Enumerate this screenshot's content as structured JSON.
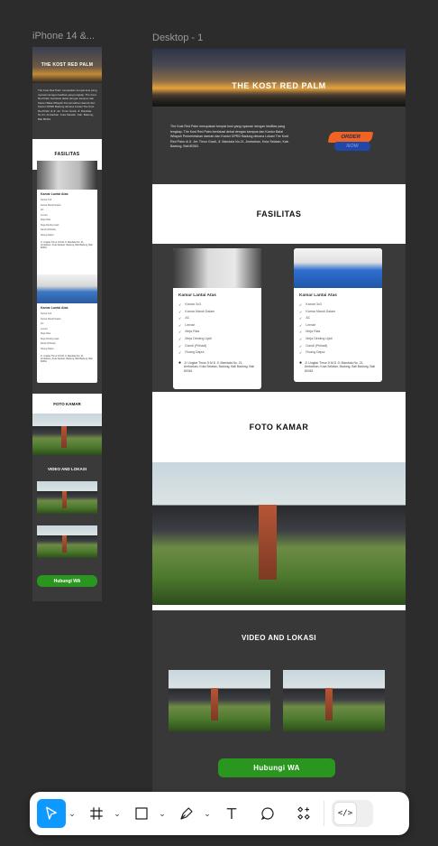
{
  "frames": {
    "mobile_label": "iPhone 14 &...",
    "desktop_label": "Desktop - 1"
  },
  "site": {
    "hero_title": "THE KOST RED PALM",
    "description": "The Kost Red Palm merupakan tempat kost yang nyaman dengan fasilitas yang lengkap. The Kost Red Palm berlokasi dekat dengan kampus dan Kantor Balai Wilayah Pemerintahan daerah dan Kantor DPRD Badung dimana Lokasi The Kost Red Palm di Jl. Jer. Timur Gradi, Jl. Mandala No.21, Ambarkan, Kuta Selatan, Kab. Badung, Bali 80361",
    "order_label": "ORDER",
    "now_label": "NOW",
    "fasilitas_title": "FASILITAS",
    "foto_title": "FOTO KAMAR",
    "video_title": "VIDEO AND LOKASI",
    "wa_label": "Hubungi WA"
  },
  "cards": [
    {
      "title": "Kamar Lantai Atas",
      "items": [
        "Kamar 3x3",
        "Kamar Mandi Dalam",
        "AC",
        "Lemari",
        "Meja Rias",
        "Meja Dinding Ujati",
        "Dandi (Pribadi)",
        "Ruang Dapur"
      ],
      "address": "Jl. Ungkar Timur Jl.M.D Jl. Mandala No. 21, Ambarkan, Kuta Selatan, Badung, Bali Badung, Bali 80361"
    },
    {
      "title": "Kamar Lantai Atas",
      "items": [
        "Kamar 3x3",
        "Kamar Mandi Dalam",
        "AC",
        "Lemari",
        "Meja Rias",
        "Meja Dinding Ujati",
        "Dandi (Pribadi)",
        "Ruang Dapur"
      ],
      "address": "Jl. Ungkar Timur Jl.M.D Jl. Mandala No. 21, Ambarkan, Kuta Selatan, Badung, Bali Badung, Bali 80361"
    }
  ],
  "mobile": {
    "fasilitas_title": "FASILITAS",
    "foto_title": "FOTO KAMAR",
    "video_title": "VIDEO AND LOKASI",
    "wa_label": "Hubungi WA"
  },
  "toolbar": {
    "tools": [
      "move-icon",
      "frame-icon",
      "rectangle-icon",
      "pen-icon",
      "text-icon",
      "comment-icon",
      "components-icon"
    ],
    "dev_mode_icon": "code-icon",
    "accent": "#0d99ff"
  }
}
